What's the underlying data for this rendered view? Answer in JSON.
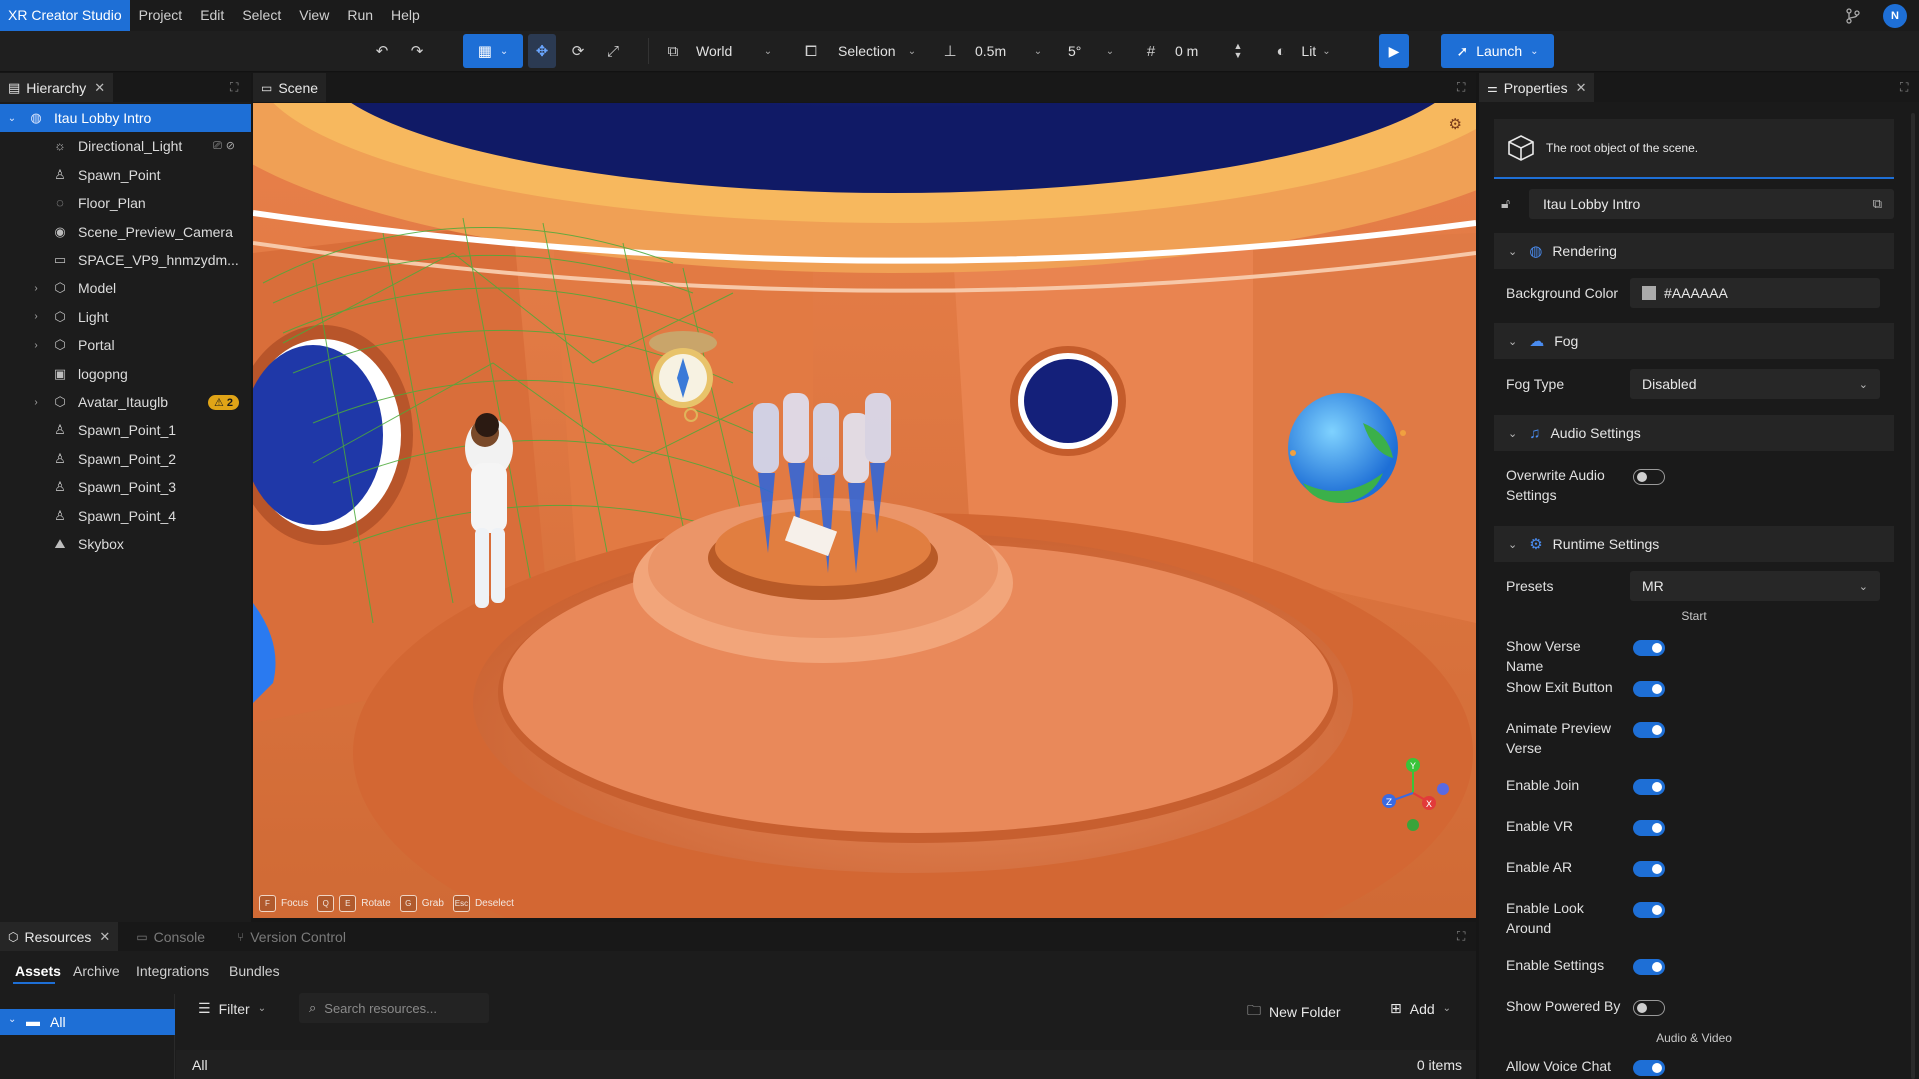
{
  "app": {
    "title": "XR Creator Studio",
    "user_initial": "N"
  },
  "menu": [
    "Project",
    "Edit",
    "Select",
    "View",
    "Run",
    "Help"
  ],
  "toolbar": {
    "space": "World",
    "snap_mode": "Selection",
    "translate_snap": "0.5m",
    "rotate_snap": "5°",
    "grid_height": "0 m",
    "render_mode": "Lit",
    "launch_label": "Launch"
  },
  "hierarchy": {
    "tab_label": "Hierarchy",
    "items": [
      {
        "label": "Itau Lobby Intro",
        "icon": "globe-icon",
        "depth": 0,
        "expanded": true,
        "selected": true
      },
      {
        "label": "Directional_Light",
        "icon": "sun-icon",
        "depth": 1
      },
      {
        "label": "Spawn_Point",
        "icon": "person-icon",
        "depth": 1
      },
      {
        "label": "Floor_Plan",
        "icon": "floor-icon",
        "depth": 1
      },
      {
        "label": "Scene_Preview_Camera",
        "icon": "camera-icon",
        "depth": 1
      },
      {
        "label": "SPACE_VP9_hnmzydm...",
        "icon": "video-icon",
        "depth": 1
      },
      {
        "label": "Model",
        "icon": "cubes-icon",
        "depth": 1,
        "collapsed": true
      },
      {
        "label": "Light",
        "icon": "cubes-icon",
        "depth": 1,
        "collapsed": true
      },
      {
        "label": "Portal",
        "icon": "cubes-icon",
        "depth": 1,
        "collapsed": true
      },
      {
        "label": "logopng",
        "icon": "image-icon",
        "depth": 1
      },
      {
        "label": "Avatar_Itauglb",
        "icon": "cube-icon",
        "depth": 1,
        "collapsed": true,
        "badge": "2"
      },
      {
        "label": "Spawn_Point_1",
        "icon": "person-icon",
        "depth": 1
      },
      {
        "label": "Spawn_Point_2",
        "icon": "person-icon",
        "depth": 1
      },
      {
        "label": "Spawn_Point_3",
        "icon": "person-icon",
        "depth": 1
      },
      {
        "label": "Spawn_Point_4",
        "icon": "person-icon",
        "depth": 1
      },
      {
        "label": "Skybox",
        "icon": "mountain-icon",
        "depth": 1
      }
    ]
  },
  "scene": {
    "tab_label": "Scene",
    "shortcuts": [
      {
        "key": "F",
        "label": "Focus"
      },
      {
        "key": "Q",
        "label": ""
      },
      {
        "key": "E",
        "label": "Rotate"
      },
      {
        "key": "G",
        "label": "Grab"
      },
      {
        "key": "Esc",
        "label": "Deselect"
      }
    ]
  },
  "properties": {
    "tab_label": "Properties",
    "description": "The root object of the scene.",
    "object_name": "Itau Lobby Intro",
    "rendering": {
      "title": "Rendering",
      "bg_label": "Background Color",
      "bg_value": "#AAAAAA"
    },
    "fog": {
      "title": "Fog",
      "type_label": "Fog Type",
      "type_value": "Disabled"
    },
    "audio": {
      "title": "Audio Settings",
      "overwrite_label": "Overwrite Audio Settings",
      "overwrite_on": false
    },
    "runtime": {
      "title": "Runtime Settings",
      "presets_label": "Presets",
      "presets_value": "MR",
      "start_label": "Start",
      "toggles": [
        {
          "label": "Show Verse Name",
          "on": true
        },
        {
          "label": "Show Exit Button",
          "on": true
        },
        {
          "label": "Animate Preview Verse",
          "on": true
        },
        {
          "label": "Enable Join",
          "on": true
        },
        {
          "label": "Enable VR",
          "on": true
        },
        {
          "label": "Enable AR",
          "on": true
        },
        {
          "label": "Enable Look Around",
          "on": true
        },
        {
          "label": "Enable Settings",
          "on": true
        },
        {
          "label": "Show Powered By",
          "on": false
        }
      ],
      "av_label": "Audio & Video",
      "voice_chat_label": "Allow Voice Chat",
      "voice_chat_on": true
    }
  },
  "resources": {
    "tabs": [
      "Resources",
      "Console",
      "Version Control"
    ],
    "subtabs": [
      "Assets",
      "Archive",
      "Integrations",
      "Bundles"
    ],
    "tree_all": "All",
    "filter_label": "Filter",
    "search_placeholder": "Search resources...",
    "new_folder_label": "New Folder",
    "add_label": "Add",
    "list_header": "All",
    "item_count": "0 items"
  },
  "colors": {
    "accent": "#1E6FD6",
    "badge": "#E0A417",
    "panel": "#1C1C1C"
  }
}
